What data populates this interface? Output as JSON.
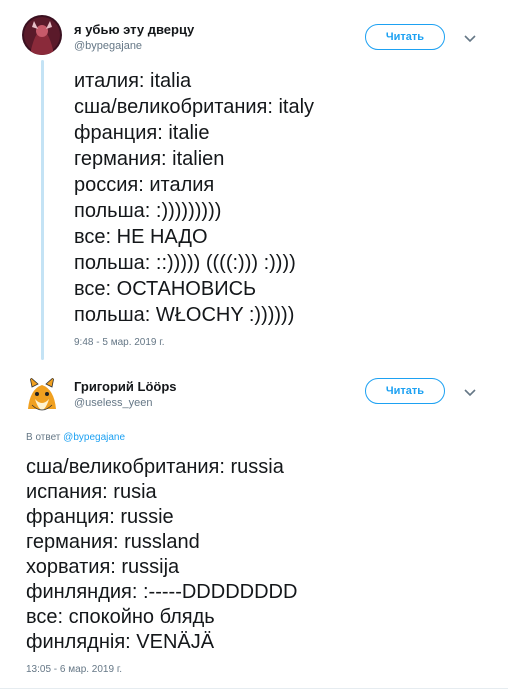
{
  "tweet1": {
    "display_name": "я убью эту дверцу",
    "handle": "@bypegajane",
    "follow_label": "Читать",
    "lines": [
      "италия: italia",
      "сша/великобритания: italy",
      "франция: italie",
      "германия: italien",
      "россия: италия",
      "польша: :)))))))))",
      "все: НЕ НАДО",
      "польша: ::))))) ((((:))) :))))",
      "все: ОСТАНОВИСЬ",
      "польша: WŁOCHY :))))))"
    ],
    "timestamp": "9:48 - 5 мар. 2019 г."
  },
  "tweet2": {
    "display_name": "Григорий Lööps",
    "handle": "@useless_yeen",
    "follow_label": "Читать",
    "reply_prefix": "В ответ",
    "reply_handle": "@bypegajane",
    "lines": [
      "сша/великобритания: russia",
      "испания: rusia",
      "франция: russie",
      "германия: russland",
      "хорватия: russija",
      "финляндия: :-----DDDDDDDD",
      "все: спокойно блядь",
      "финляднія: VENÄJÄ"
    ],
    "timestamp": "13:05 - 6 мар. 2019 г."
  },
  "icons": {
    "more": "chevron-down-icon"
  },
  "colors": {
    "accent": "#1da1f2",
    "thread_line": "#c4e3f5",
    "muted": "#657786"
  }
}
